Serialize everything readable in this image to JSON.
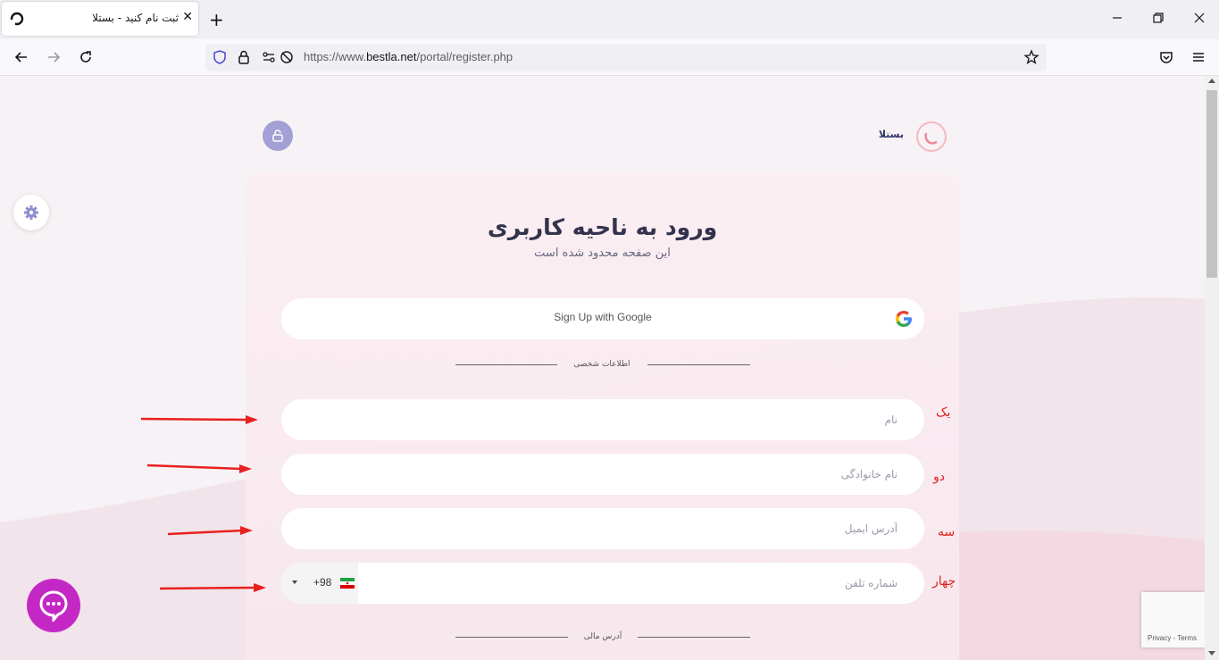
{
  "browser": {
    "tab_title": "ثبت نام کنید - بستلا",
    "url_prefix": "https://www.",
    "url_domain": "bestla.net",
    "url_path": "/portal/register.php"
  },
  "site": {
    "brand_name": "بستلا"
  },
  "header": {
    "title": "ورود به ناحیه کاربری",
    "subtitle": "این صفحه محدود شده است"
  },
  "google": {
    "label": "Sign Up with Google"
  },
  "sections": {
    "personal": "اطلاعات شخصی",
    "address": "آدرس مالی"
  },
  "form": {
    "first_name_placeholder": "نام",
    "last_name_placeholder": "نام خانوادگی",
    "email_placeholder": "آدرس ایمیل",
    "phone_placeholder": "شماره تلفن",
    "phone_code": "+98"
  },
  "annotations": {
    "one": "یک",
    "two": "دو",
    "three": "سه",
    "four": "چهار"
  },
  "recaptcha": {
    "privacy": "Privacy",
    "separator": " - ",
    "terms": "Terms"
  },
  "colors": {
    "accent": "#a2a0d4",
    "annotation": "#e02020",
    "chat": "#c428c4"
  }
}
